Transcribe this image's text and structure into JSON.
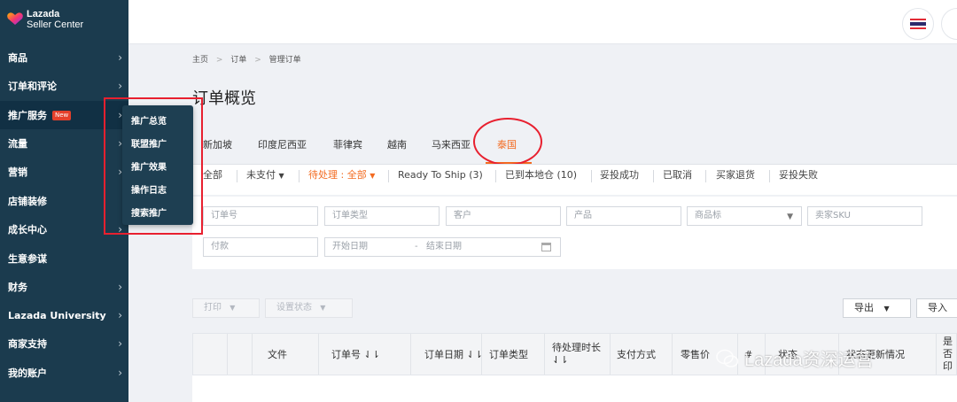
{
  "logo": {
    "line1": "Lazada",
    "line2": "Seller Center"
  },
  "sidebar": {
    "items": [
      {
        "label": "商品"
      },
      {
        "label": "订单和评论"
      },
      {
        "label": "推广服务",
        "badge": "New"
      },
      {
        "label": "流量"
      },
      {
        "label": "营销"
      },
      {
        "label": "店铺装修"
      },
      {
        "label": "成长中心"
      },
      {
        "label": "生意参谋"
      },
      {
        "label": "财务"
      },
      {
        "label": "Lazada University"
      },
      {
        "label": "商家支持"
      },
      {
        "label": "我的账户"
      }
    ]
  },
  "flyout": {
    "items": [
      "推广总览",
      "联盟推广",
      "推广效果",
      "操作日志",
      "搜索推广"
    ]
  },
  "breadcrumb": {
    "home": "主页",
    "orders": "订单",
    "current": "管理订单",
    "sep": ">"
  },
  "page_title": "订单概览",
  "countries": [
    "新加坡",
    "印度尼西亚",
    "菲律宾",
    "越南",
    "马来西亚",
    "泰国"
  ],
  "active_country": "泰国",
  "status_tabs": {
    "all": "全部",
    "unpaid": "未支付",
    "pending": "待处理 : 全部",
    "ready_to_ship": "Ready To Ship (3)",
    "arrived": "已到本地仓 (10)",
    "delivered": "妥投成功",
    "cancelled": "已取消",
    "returned": "买家退货",
    "failed": "妥投失败"
  },
  "filters": {
    "order_no": "订单号",
    "order_type": "订单类型",
    "customer": "客户",
    "product": "产品",
    "product_tag": "商品标",
    "seller_sku": "卖家SKU",
    "payment": "付款",
    "start_date": "开始日期",
    "date_sep": "-",
    "end_date": "结束日期"
  },
  "toolbar": {
    "print": "打印",
    "set_status": "设置状态",
    "export": "导出",
    "import": "导入"
  },
  "table": {
    "columns": [
      "文件",
      "订单号 ⇃⇂",
      "订单日期 ⇃⇂",
      "订单类型",
      "待处理时长",
      "⇃⇂",
      "支付方式",
      "零售价",
      "#",
      "状态",
      "状态更新情况",
      "是否",
      "印"
    ]
  },
  "watermark": "Lazada资深运营",
  "colors": {
    "sidebar_bg": "#1b3b4e",
    "accent": "#f36b21",
    "annotation_red": "#e8202f"
  }
}
